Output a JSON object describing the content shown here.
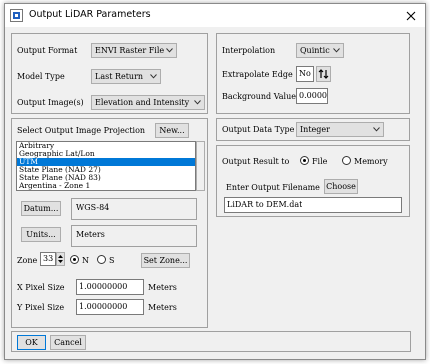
{
  "window": {
    "title": "Output LiDAR Parameters"
  },
  "format_group": {
    "output_format_label": "Output Format",
    "output_format_value": "ENVI Raster File",
    "model_type_label": "Model Type",
    "model_type_value": "Last Return",
    "output_images_label": "Output Image(s)",
    "output_images_value": "Elevation and Intensity"
  },
  "interp_group": {
    "interpolation_label": "Interpolation",
    "interpolation_value": "Quintic",
    "extrapolate_label": "Extrapolate Edge",
    "extrapolate_value": "No",
    "background_label": "Background Value",
    "background_value": "0.0000"
  },
  "projection_group": {
    "select_label": "Select Output Image Projection",
    "new_button": "New...",
    "projections": [
      "Arbitrary",
      "Geographic Lat/Lon",
      "UTM",
      "State Plane (NAD 27)",
      "State Plane (NAD 83)",
      "Argentina - Zone 1"
    ],
    "selected_projection": "UTM",
    "datum_button": "Datum...",
    "datum_value": "WGS-84",
    "units_button": "Units...",
    "units_value": "Meters",
    "zone_label": "Zone",
    "zone_value": "33",
    "north_label": "N",
    "south_label": "S",
    "hemisphere_selected": "N",
    "set_zone_button": "Set Zone...",
    "x_pixel_label": "X Pixel Size",
    "x_pixel_value": "1.00000000",
    "x_pixel_units": "Meters",
    "y_pixel_label": "Y Pixel Size",
    "y_pixel_value": "1.00000000",
    "y_pixel_units": "Meters"
  },
  "data_type_group": {
    "label": "Output Data Type",
    "value": "Integer"
  },
  "output_group": {
    "result_label": "Output Result to",
    "file_label": "File",
    "memory_label": "Memory",
    "result_selected": "File",
    "filename_label": "Enter Output Filename",
    "choose_button": "Choose",
    "filename_value": "LiDAR to DEM.dat"
  },
  "footer": {
    "ok_button": "OK",
    "cancel_button": "Cancel"
  }
}
